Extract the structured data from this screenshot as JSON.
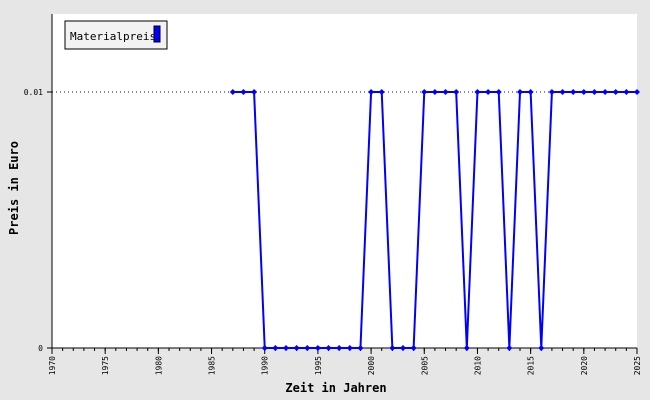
{
  "chart_data": {
    "type": "line",
    "xlabel": "Zeit in Jahren",
    "ylabel": "Preis in Euro",
    "legend": {
      "label": "Materialpreis",
      "placement": "top-left"
    },
    "xlim": [
      1970,
      2025
    ],
    "ylim": [
      0,
      0.012
    ],
    "x_ticks": [
      "1970",
      "1975",
      "1980",
      "1985",
      "1990",
      "1995",
      "2000",
      "2005",
      "2010",
      "2015",
      "2020",
      "2025"
    ],
    "y_ticks": [
      {
        "value": 0,
        "label": "0"
      },
      {
        "value": 0.01,
        "label": "0.01"
      }
    ],
    "reference_lines": [
      {
        "value": 0.01
      }
    ],
    "grid": false,
    "series": [
      {
        "name": "Materialpreis",
        "color": "#0000ff",
        "x": [
          1987,
          1988,
          1989,
          1990,
          1991,
          1992,
          1993,
          1994,
          1995,
          1996,
          1997,
          1998,
          1999,
          2000,
          2001,
          2002,
          2003,
          2004,
          2005,
          2006,
          2007,
          2008,
          2009,
          2010,
          2011,
          2012,
          2013,
          2014,
          2015,
          2016,
          2017,
          2018,
          2019,
          2020,
          2021,
          2022,
          2023,
          2024,
          2025
        ],
        "values": [
          0.01,
          0.01,
          0.01,
          0,
          0,
          0,
          0,
          0,
          0,
          0,
          0,
          0,
          0,
          0.01,
          0.01,
          0,
          0,
          0,
          0.01,
          0.01,
          0.01,
          0.01,
          0,
          0.01,
          0.01,
          0.01,
          0,
          0.01,
          0.01,
          0,
          0.01,
          0.01,
          0.01,
          0.01,
          0.01,
          0.01,
          0.01,
          0.01,
          0.01
        ]
      }
    ]
  }
}
